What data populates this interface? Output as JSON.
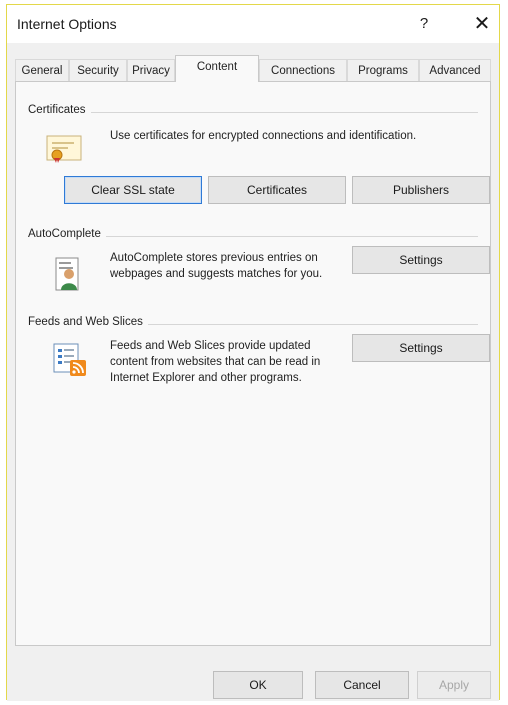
{
  "window": {
    "title": "Internet Options",
    "help_glyph": "?",
    "close_glyph": "✕"
  },
  "tabs": [
    {
      "label": "General",
      "active": false
    },
    {
      "label": "Security",
      "active": false
    },
    {
      "label": "Privacy",
      "active": false
    },
    {
      "label": "Content",
      "active": true
    },
    {
      "label": "Connections",
      "active": false
    },
    {
      "label": "Programs",
      "active": false
    },
    {
      "label": "Advanced",
      "active": false
    }
  ],
  "certificates": {
    "heading": "Certificates",
    "description": "Use certificates for encrypted connections and identification.",
    "buttons": {
      "clear_ssl": "Clear SSL state",
      "certificates": "Certificates",
      "publishers": "Publishers"
    },
    "icon": "certificate-icon"
  },
  "autocomplete": {
    "heading": "AutoComplete",
    "description": "AutoComplete stores previous entries on webpages and suggests matches for you.",
    "settings": "Settings",
    "icon": "autocomplete-user-icon"
  },
  "feeds": {
    "heading": "Feeds and Web Slices",
    "description": "Feeds and Web Slices provide updated content from websites that can be read in Internet Explorer and other programs.",
    "settings": "Settings",
    "icon": "rss-feed-icon"
  },
  "footer": {
    "ok": "OK",
    "cancel": "Cancel",
    "apply": "Apply"
  },
  "colors": {
    "window_border": "#e3d84a",
    "focus_border": "#2f7ad6",
    "rss_orange": "#f08a1c"
  }
}
